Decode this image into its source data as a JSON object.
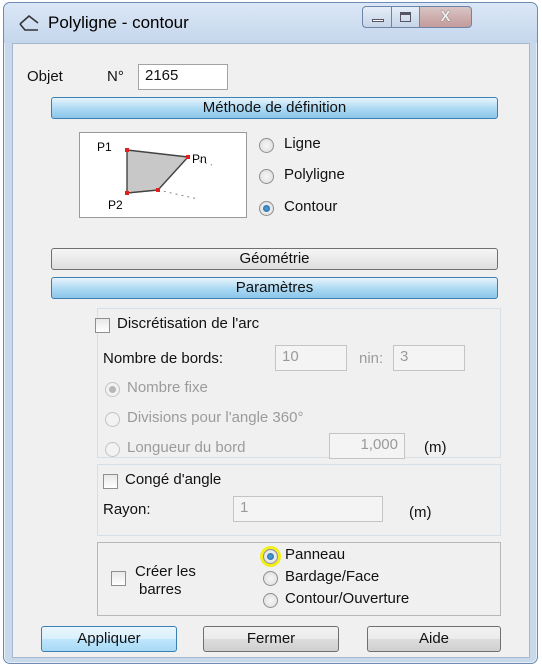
{
  "window": {
    "title": "Polyligne - contour",
    "close_glyph": "X"
  },
  "object": {
    "label": "Objet",
    "number_label": "N°",
    "number_value": "2165"
  },
  "sections": {
    "method": "Méthode de définition",
    "geometry": "Géométrie",
    "parameters": "Paramètres"
  },
  "preview": {
    "p1": "P1",
    "pn": "Pn",
    "p2": "P2"
  },
  "method_options": [
    {
      "label": "Ligne",
      "checked": false
    },
    {
      "label": "Polyligne",
      "checked": false
    },
    {
      "label": "Contour",
      "checked": true
    }
  ],
  "arc": {
    "checkbox_label": "Discrétisation de l'arc",
    "edges_label": "Nombre de bords:",
    "edges_value": "10",
    "min_label": "nin:",
    "min_value": "3",
    "options": [
      {
        "label": "Nombre fixe",
        "checked": true
      },
      {
        "label": "Divisions pour l'angle 360°",
        "checked": false
      },
      {
        "label": "Longueur du bord",
        "checked": false
      }
    ],
    "length_value": "1,000",
    "length_unit": "(m)"
  },
  "fillet": {
    "checkbox_label": "Congé d'angle",
    "radius_label": "Rayon:",
    "radius_value": "1",
    "radius_unit": "(m)"
  },
  "bars": {
    "checkbox_label_line1": "Créer les",
    "checkbox_label_line2": "barres",
    "options": [
      {
        "label": "Panneau",
        "checked": true
      },
      {
        "label": "Bardage/Face",
        "checked": false
      },
      {
        "label": "Contour/Ouverture",
        "checked": false
      }
    ]
  },
  "buttons": {
    "apply": "Appliquer",
    "close": "Fermer",
    "help": "Aide"
  },
  "colors": {
    "active_section": "#aad8f3",
    "highlight": "#f2ee1a",
    "polygon_fill": "#c8c8c8",
    "vertex": "#e02020"
  }
}
